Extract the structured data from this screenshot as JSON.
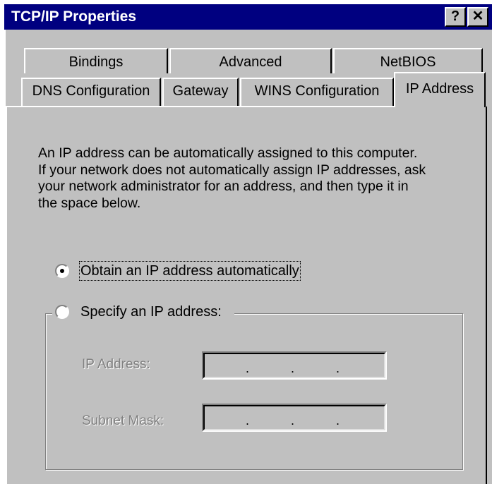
{
  "window": {
    "title": "TCP/IP Properties",
    "help_button": "?",
    "close_button": "✕"
  },
  "tabs": {
    "row1": [
      "Bindings",
      "Advanced",
      "NetBIOS"
    ],
    "row2": [
      "DNS Configuration",
      "Gateway",
      "WINS Configuration",
      "IP Address"
    ],
    "active": "IP Address"
  },
  "panel": {
    "description_lines": [
      "An IP address can be automatically assigned to this computer.",
      "If your network does not automatically assign IP addresses, ask",
      "your network administrator for an address, and then type it in",
      "the space below."
    ],
    "options": {
      "obtain_automatically": "Obtain an IP address automatically",
      "specify": "Specify an IP address:",
      "selected": "obtain_automatically"
    },
    "fields": {
      "ip_address_label": "IP Address:",
      "subnet_mask_label": "Subnet Mask:",
      "ip_address_value": [
        "",
        "",
        "",
        ""
      ],
      "subnet_mask_value": [
        "",
        "",
        "",
        ""
      ],
      "separator": "."
    }
  }
}
